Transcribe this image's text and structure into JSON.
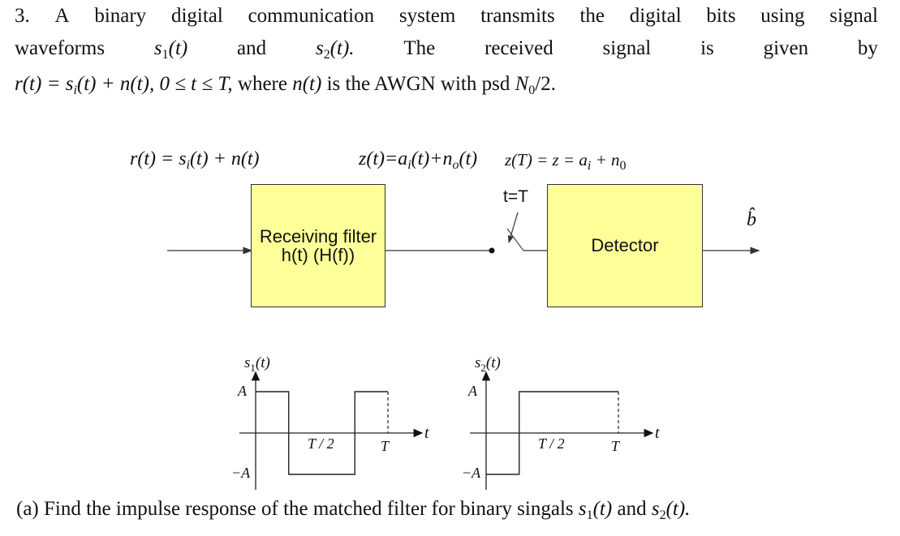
{
  "problem": {
    "number": "3.",
    "line1_words": [
      "3.",
      "A",
      "binary",
      "digital",
      "communication",
      "system",
      "transmits",
      "the",
      "digital",
      "bits",
      "using",
      "signal"
    ],
    "line2": {
      "word1": "waveforms",
      "s1": "s",
      "s1_sub": "1",
      "s1_arg": "(t)",
      "and": "and",
      "s2": "s",
      "s2_sub": "2",
      "s2_arg": "(t).",
      "the": "The",
      "received": "received",
      "signal": "signal",
      "is": "is",
      "given": "given",
      "by": "by"
    },
    "line3": {
      "eq_r": "r(t) = s",
      "eq_i": "i",
      "eq_rest": "(t) + n(t), 0 ≤ t ≤ T,",
      "where": " where ",
      "nt": "n(t)",
      "text": " is the AWGN with psd ",
      "N": "N",
      "N_sub": "0",
      "over2": "/2."
    }
  },
  "diagram": {
    "input_label": {
      "pre": "r(t) = s",
      "sub": "i",
      "post": "(t) + n(t)"
    },
    "filter_output_label": {
      "pre": "z(t)=a",
      "sub1": "i",
      "mid": "(t)+n",
      "sub2": "o",
      "post": "(t)"
    },
    "sample_label": {
      "pre": "z(T) = z = a",
      "sub1": "i",
      "mid": " + n",
      "sub2": "0"
    },
    "filter_block": {
      "line1": "Receiving filter",
      "line2": "h(t) (H(f))"
    },
    "switch_label": "t=T",
    "detector_block": {
      "label": "Detector"
    },
    "output_label": "b̂",
    "colors": {
      "block_fill": "#ffff99",
      "block_border": "#333333",
      "line": "#555555"
    }
  },
  "waveforms": [
    {
      "name": "s1",
      "ylabel": "s",
      "ylabel_sub": "1",
      "ylabel_arg": "(t)",
      "level_high": "A",
      "level_low": "−A",
      "tick_half": "T / 2",
      "tick_T": "T",
      "xlabel": "t",
      "segments": [
        {
          "t_start": 0,
          "t_end": 0.25,
          "level": 1
        },
        {
          "t_start": 0.25,
          "t_end": 0.75,
          "level": -1
        },
        {
          "t_start": 0.75,
          "t_end": 1.0,
          "level": 1
        }
      ]
    },
    {
      "name": "s2",
      "ylabel": "s",
      "ylabel_sub": "2",
      "ylabel_arg": "(t)",
      "level_high": "A",
      "level_low": "−A",
      "tick_half": "T / 2",
      "tick_T": "T",
      "xlabel": "t",
      "segments": [
        {
          "t_start": 0,
          "t_end": 0.25,
          "level": -1
        },
        {
          "t_start": 0.25,
          "t_end": 1.0,
          "level": 1
        }
      ]
    }
  ],
  "question_a": {
    "text": "(a) Find the impulse response of the matched filter for binary singals ",
    "s1": "s",
    "s1_sub": "1",
    "s1_arg": "(t)",
    "and": " and ",
    "s2": "s",
    "s2_sub": "2",
    "s2_arg": "(t)."
  }
}
